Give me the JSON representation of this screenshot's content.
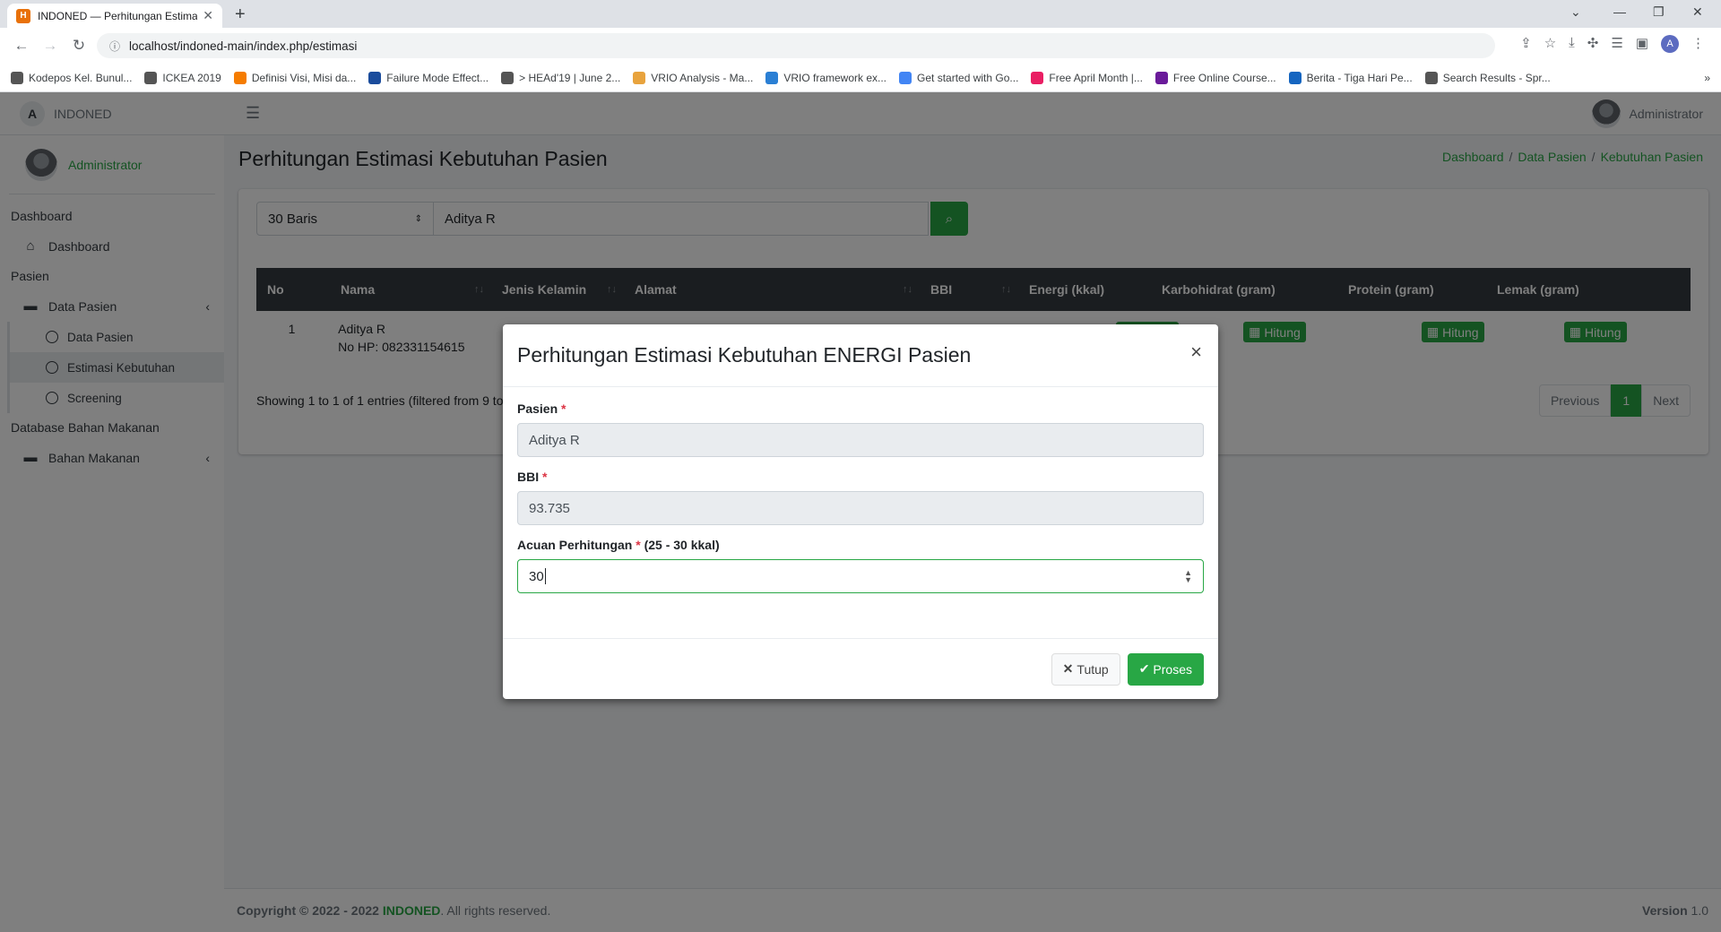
{
  "browser": {
    "tab_title": "INDONED — Perhitungan Estima",
    "tab_favicon": "H",
    "url": "localhost/indoned-main/index.php/estimasi",
    "profile_letter": "A",
    "bookmarks": [
      {
        "label": "Kodepos Kel. Bunul...",
        "color": "#555555"
      },
      {
        "label": "ICKEA 2019",
        "color": "#555555"
      },
      {
        "label": "Definisi Visi, Misi da...",
        "color": "#f57c00"
      },
      {
        "label": "Failure Mode Effect...",
        "color": "#1a4c9c"
      },
      {
        "label": "> HEAd'19 | June 2...",
        "color": "#555555"
      },
      {
        "label": "VRIO Analysis - Ma...",
        "color": "#e8a33d"
      },
      {
        "label": "VRIO framework ex...",
        "color": "#2a7fd4"
      },
      {
        "label": "Get started with Go...",
        "color": "#4285f4"
      },
      {
        "label": "Free April Month |...",
        "color": "#e91e63"
      },
      {
        "label": "Free Online Course...",
        "color": "#6a1b9a"
      },
      {
        "label": "Berita - Tiga Hari Pe...",
        "color": "#1565c0"
      },
      {
        "label": "Search Results - Spr...",
        "color": "#555555"
      }
    ]
  },
  "app": {
    "brand": "INDONED",
    "brand_logo": "A",
    "user": "Administrator",
    "top_user": "Administrator",
    "nav": {
      "header_dashboard": "Dashboard",
      "item_dashboard": "Dashboard",
      "header_pasien": "Pasien",
      "item_data_pasien": "Data Pasien",
      "sub_data_pasien": "Data Pasien",
      "sub_estimasi": "Estimasi Kebutuhan",
      "sub_screening": "Screening",
      "header_bahan": "Database Bahan Makanan",
      "item_bahan": "Bahan Makanan"
    },
    "page_title": "Perhitungan Estimasi Kebutuhan Pasien",
    "breadcrumb": [
      "Dashboard",
      "Data Pasien",
      "Kebutuhan Pasien"
    ],
    "filter": {
      "rows": "30 Baris",
      "search": "Aditya R"
    },
    "table": {
      "columns": [
        "No",
        "Nama",
        "Jenis Kelamin",
        "Alamat",
        "BBI",
        "Energi (kkal)",
        "Karbohidrat (gram)",
        "Protein (gram)",
        "Lemak (gram)"
      ],
      "row": {
        "no": "1",
        "nama": "Aditya R",
        "hp": "No HP: 082331154615",
        "btn": "Hitung"
      }
    },
    "showing": "Showing 1 to 1 of 1 entries (filtered from 9 to",
    "pager": {
      "prev": "Previous",
      "page": "1",
      "next": "Next"
    },
    "footer": {
      "copyright": "Copyright © 2022 - 2022",
      "brand": "INDONED",
      "rights": ". All rights reserved.",
      "version_label": "Version",
      "version": "1.0"
    }
  },
  "modal": {
    "title": "Perhitungan Estimasi Kebutuhan ENERGI Pasien",
    "close": "×",
    "fields": [
      {
        "label": "Pasien",
        "required": "*",
        "value": "Aditya R"
      },
      {
        "label": "BBI",
        "required": "*",
        "value": "93.735"
      },
      {
        "label": "Acuan Perhitungan",
        "required": "*",
        "hint": "(25 - 30 kkal)",
        "value": "30"
      }
    ],
    "btn_close": "Tutup",
    "btn_process": "Proses"
  },
  "colors": {
    "accent": "#28a745",
    "dark": "#343a40",
    "required": "#dc3545"
  }
}
